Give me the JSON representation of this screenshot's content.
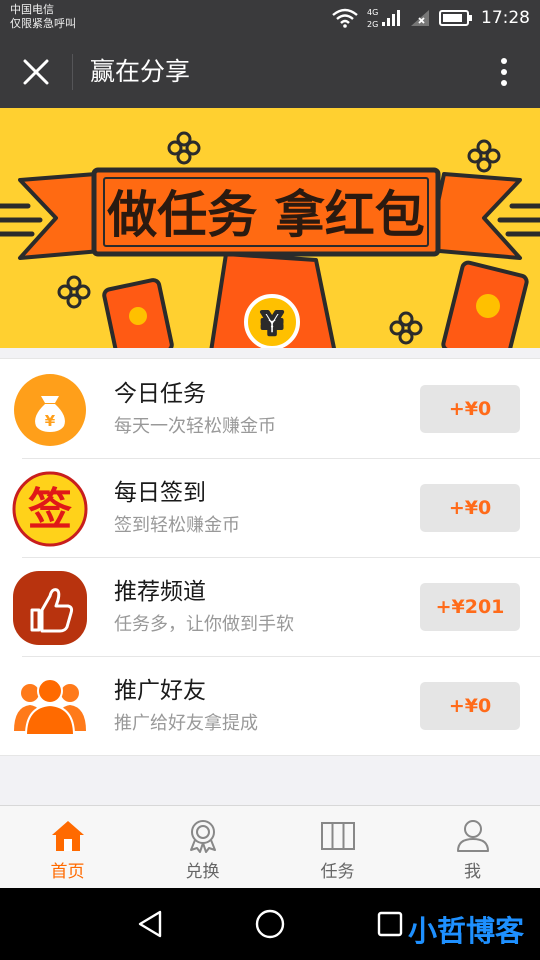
{
  "status_bar": {
    "carrier_line1": "中国电信",
    "carrier_line2": "仅限紧急呼叫",
    "time": "17:28",
    "network_4g": "4G",
    "network_2g": "2G"
  },
  "header": {
    "title": "赢在分享"
  },
  "banner": {
    "headline": "做任务 拿红包",
    "currency_glyph": "¥"
  },
  "tasks": [
    {
      "name": "今日任务",
      "desc": "每天一次轻松赚金币",
      "reward": "+¥0",
      "icon": "money-bag-icon"
    },
    {
      "name": "每日签到",
      "desc": "签到轻松赚金币",
      "reward": "+¥0",
      "icon": "sign-in-icon",
      "icon_text": "签"
    },
    {
      "name": "推荐频道",
      "desc": "任务多，让你做到手软",
      "reward": "+¥201",
      "icon": "thumbs-up-icon"
    },
    {
      "name": "推广好友",
      "desc": "推广给好友拿提成",
      "reward": "+¥0",
      "icon": "people-icon"
    }
  ],
  "tabbar": {
    "tabs": [
      {
        "label": "首页",
        "icon": "home-icon",
        "active": true
      },
      {
        "label": "兑换",
        "icon": "badge-icon",
        "active": false
      },
      {
        "label": "任务",
        "icon": "task-grid-icon",
        "active": false
      },
      {
        "label": "我",
        "icon": "person-icon",
        "active": false
      }
    ]
  },
  "watermark": "小哲博客",
  "colors": {
    "accent": "#ff6a00",
    "banner_bg": "#ffd030",
    "header_bg": "#3a3a3c"
  }
}
